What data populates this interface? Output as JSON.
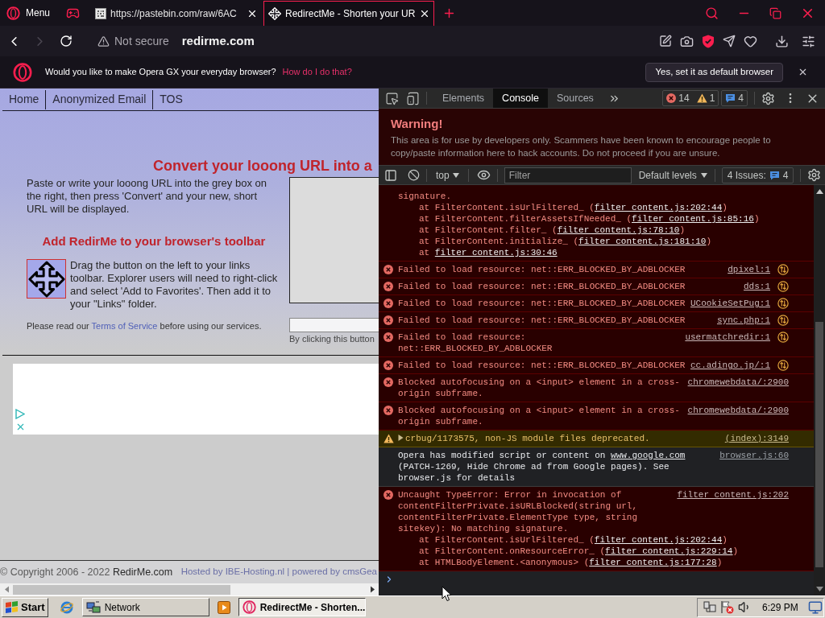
{
  "tab_bar": {
    "menu_label": "Menu",
    "tabs": [
      {
        "title": "https://pastebin.com/raw/6AC",
        "selected": false
      },
      {
        "title": "RedirectMe - Shorten your UR",
        "selected": true
      }
    ]
  },
  "address_bar": {
    "security_label": "Not secure",
    "url": "redirme.com",
    "forward_disabled": true
  },
  "default_browser_bar": {
    "message": "Would you like to make Opera GX your everyday browser?",
    "link": "How do I do that?",
    "button": "Yes, set it as default browser"
  },
  "page": {
    "nav": [
      {
        "label": "Home"
      },
      {
        "label": "Anonymized Email"
      },
      {
        "label": "TOS"
      }
    ],
    "heading": "Convert your looong URL into a",
    "intro": "Paste or write your looong URL into the grey box on the right, then press 'Convert' and your new, short URL will be displayed.",
    "toolbar_heading": "Add RedirMe to your browser's toolbar",
    "toolbar_text": "Drag the button on the left to your links toolbar. Explorer users will need to right-click and select 'Add to Favorites'. Then add it to your \"Links\" folder.",
    "terms": {
      "before": "Please read our ",
      "link": "Terms of Service",
      "after": " before using our services."
    },
    "button_note": "By clicking this button",
    "footer": {
      "copyright": "© Copyright 2006 - 2022",
      "site_link": "RedirMe.com",
      "hosting": "Hosted by IBE-Hosting.nl | powered by cmsGea"
    }
  },
  "devtools": {
    "tabs": [
      {
        "label": "Elements",
        "selected": false
      },
      {
        "label": "Console",
        "selected": true
      },
      {
        "label": "Sources",
        "selected": false
      }
    ],
    "error_count": "14",
    "warning_count": "1",
    "issue_count": "4",
    "warning_banner": {
      "title": "Warning!",
      "text": "This area is for use by developers only. Scammers have been known to encourage people to copy/paste information here to hack accounts. Do not proceed if you are unsure."
    },
    "console_toolbar": {
      "context": "top",
      "filter_placeholder": "Filter",
      "levels": "Default levels",
      "issues_label": "4 Issues:",
      "issues_count": "4"
    },
    "messages": [
      {
        "kind": "error_continued",
        "text": "signature.",
        "network": false,
        "stack": [
          {
            "text": "at FilterContent.isUrlFiltered_ (",
            "link": "filter content.js:202:44",
            "end": ")"
          },
          {
            "text": "at FilterContent.filterAssetsIfNeeded_ (",
            "link": "filter content.js:85:16",
            "end": ")"
          },
          {
            "text": "at FilterContent.filter_ (",
            "link": "filter content.js:78:10",
            "end": ")"
          },
          {
            "text": "at FilterContent.initialize_ (",
            "link": "filter content.js:181:10",
            "end": ")"
          },
          {
            "text": "at ",
            "link": "filter content.js:30:46"
          }
        ]
      },
      {
        "kind": "error",
        "text": "Failed to load resource: net::ERR_BLOCKED_BY_ADBLOCKER",
        "source": "dpixel:1",
        "network": true
      },
      {
        "kind": "error",
        "text": "Failed to load resource: net::ERR_BLOCKED_BY_ADBLOCKER",
        "source": "dds:1",
        "network": true
      },
      {
        "kind": "error",
        "text": "Failed to load resource: net::ERR_BLOCKED_BY_ADBLOCKER",
        "source": "UCookieSetPug:1",
        "network": true
      },
      {
        "kind": "error",
        "text": "Failed to load resource: net::ERR_BLOCKED_BY_ADBLOCKER",
        "source": "sync.php:1",
        "network": true
      },
      {
        "kind": "error",
        "text": "Failed to load resource: net::ERR_BLOCKED_BY_ADBLOCKER",
        "source": "usermatchredir:1",
        "network": true
      },
      {
        "kind": "error",
        "text": "Failed to load resource: net::ERR_BLOCKED_BY_ADBLOCKER",
        "source": "cc.adingo.jp/:1",
        "network": true
      },
      {
        "kind": "error",
        "text": "Blocked autofocusing on a <input> element in a cross-origin subframe.",
        "source": "chromewebdata/:2900",
        "network": false
      },
      {
        "kind": "error",
        "text": "Blocked autofocusing on a <input> element in a cross-origin subframe.",
        "source": "chromewebdata/:2900",
        "network": false
      },
      {
        "kind": "warning",
        "expanded": false,
        "text": "crbug/1173575, non-JS module files deprecated.",
        "source": "(index):3149",
        "network": false
      },
      {
        "kind": "info",
        "text": "Opera has modified script or content on ",
        "link": "www.google.com",
        "text_after": " (PATCH-1269, Hide Chrome ad from Google pages). See browser.js for details",
        "source": "browser.js:60",
        "network": false
      },
      {
        "kind": "error",
        "text": "Uncaught TypeError: Error in invocation of contentFilterPrivate.isURLBlocked(string url, contentFilterPrivate.ElementType type, string sitekey): No matching signature.",
        "source": "filter content.js:202",
        "network": false,
        "stack": [
          {
            "text": "at FilterContent.isUrlFiltered_ (",
            "link": "filter content.js:202:44",
            "end": ")"
          },
          {
            "text": "at FilterContent.onResourceError_ (",
            "link": "filter content.js:229:14",
            "end": ")"
          },
          {
            "text": "at HTMLBodyElement.<anonymous> (",
            "link": "filter content.js:177:28",
            "end": ")"
          }
        ]
      }
    ]
  },
  "taskbar": {
    "start": "Start",
    "buttons": [
      {
        "label": "Network",
        "selected": false
      },
      {
        "label": "RedirectMe - Shorten...",
        "selected": true
      }
    ],
    "clock": "6:29 PM"
  }
}
